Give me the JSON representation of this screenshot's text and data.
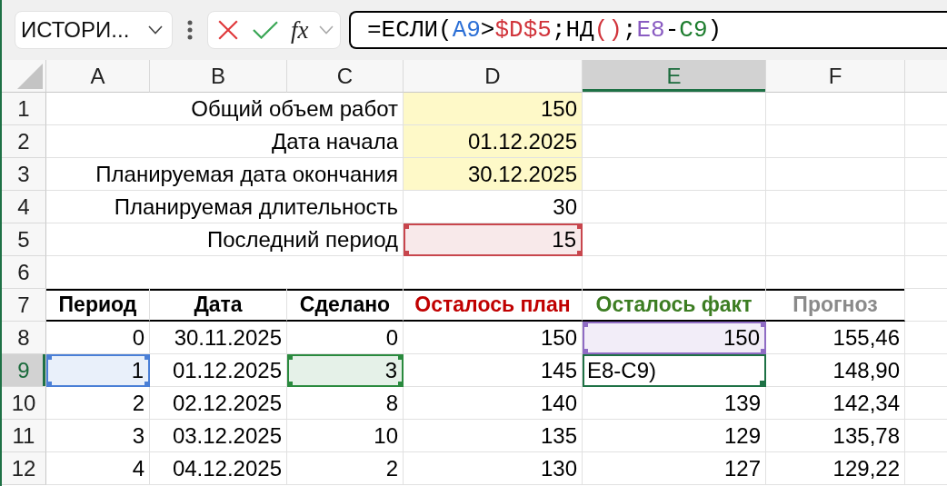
{
  "formula_bar": {
    "name_box": "ИСТОРИ...",
    "function_button": "fx",
    "formula": [
      {
        "text": "=ЕСЛИ(",
        "color": "#000000"
      },
      {
        "text": "A9",
        "color": "#2b6fd6"
      },
      {
        "text": ">",
        "color": "#000000"
      },
      {
        "text": "$D$5",
        "color": "#d1343b"
      },
      {
        "text": ";НД",
        "color": "#000000"
      },
      {
        "text": "()",
        "color": "#d1343b"
      },
      {
        "text": ";",
        "color": "#000000"
      },
      {
        "text": "E8",
        "color": "#8a5cc2"
      },
      {
        "text": "-",
        "color": "#000000"
      },
      {
        "text": "C9",
        "color": "#1d7d2e"
      },
      {
        "text": ")",
        "color": "#000000"
      }
    ]
  },
  "columns": [
    {
      "label": "A",
      "selected": false
    },
    {
      "label": "B",
      "selected": false
    },
    {
      "label": "C",
      "selected": false
    },
    {
      "label": "D",
      "selected": false
    },
    {
      "label": "E",
      "selected": true
    },
    {
      "label": "F",
      "selected": false
    }
  ],
  "summary": [
    {
      "row": "1",
      "selected": false,
      "label": "Общий объем работ",
      "value": {
        "text": "150",
        "kind": "input",
        "color": "#fef9c8"
      }
    },
    {
      "row": "2",
      "selected": false,
      "label": "Дата начала",
      "value": {
        "text": "01.12.2025",
        "kind": "input",
        "color": "#fef9c8"
      }
    },
    {
      "row": "3",
      "selected": false,
      "label": "Планируемая дата окончания",
      "value": {
        "text": "30.12.2025",
        "kind": "input",
        "color": "#fef9c8"
      }
    },
    {
      "row": "4",
      "selected": false,
      "label": "Планируемая длительность",
      "value": {
        "text": "30"
      }
    },
    {
      "row": "5",
      "selected": false,
      "label": "Последний период",
      "value": {
        "text": "15",
        "kind": "reference",
        "color": "#c8464d"
      }
    },
    {
      "row": "6",
      "selected": false
    }
  ],
  "table": {
    "header_row": {
      "row": "7",
      "selected": false,
      "headings": [
        {
          "text": "Период",
          "color": "#000000"
        },
        {
          "text": "Дата",
          "color": "#000000"
        },
        {
          "text": "Сделано",
          "color": "#000000"
        },
        {
          "text": "Осталось план",
          "color": "#c00000"
        },
        {
          "text": "Осталось факт",
          "color": "#3c7d22"
        },
        {
          "text": "Прогноз",
          "color": "#8a8a8a"
        }
      ]
    },
    "rows": [
      {
        "row": "8",
        "selected": false,
        "cells": [
          {
            "text": "0"
          },
          {
            "text": "30.11.2025"
          },
          {
            "text": "0"
          },
          {
            "text": "150"
          },
          {
            "text": "150",
            "kind": "reference",
            "color": "#8f6cc4"
          },
          {
            "text": "155,46"
          }
        ]
      },
      {
        "row": "9",
        "selected": true,
        "cells": [
          {
            "text": "1",
            "kind": "reference",
            "color": "#4a7fd6"
          },
          {
            "text": "01.12.2025"
          },
          {
            "text": "3",
            "kind": "reference",
            "color": "#2a8a3e"
          },
          {
            "text": "145"
          },
          {
            "text": "E8-C9)",
            "kind": "editing"
          },
          {
            "text": "148,90"
          }
        ]
      },
      {
        "row": "10",
        "selected": false,
        "cells": [
          {
            "text": "2"
          },
          {
            "text": "02.12.2025"
          },
          {
            "text": "8"
          },
          {
            "text": "140"
          },
          {
            "text": "139"
          },
          {
            "text": "142,34"
          }
        ]
      },
      {
        "row": "11",
        "selected": false,
        "cells": [
          {
            "text": "3"
          },
          {
            "text": "03.12.2025"
          },
          {
            "text": "10"
          },
          {
            "text": "135"
          },
          {
            "text": "129"
          },
          {
            "text": "135,78"
          }
        ]
      },
      {
        "row": "12",
        "selected": false,
        "cells": [
          {
            "text": "4"
          },
          {
            "text": "04.12.2025"
          },
          {
            "text": "2"
          },
          {
            "text": "130"
          },
          {
            "text": "127"
          },
          {
            "text": "129,22"
          }
        ]
      }
    ]
  }
}
